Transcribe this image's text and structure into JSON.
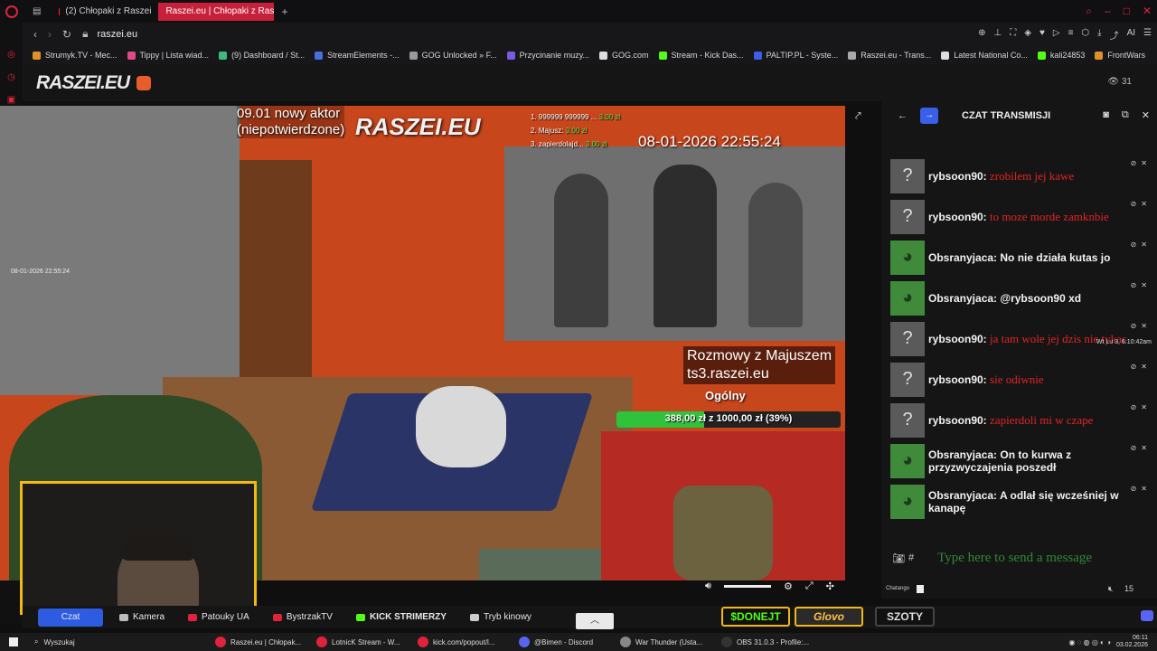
{
  "browser": {
    "tabs": [
      {
        "label": "(2) Chłopaki z Raszei"
      },
      {
        "label": "Raszei.eu | Chłopaki z Ras"
      }
    ],
    "url": "raszei.eu",
    "bookmarks": [
      {
        "label": "Strumyk.TV - Mec...",
        "icon": "orange",
        "color": "#e0902a"
      },
      {
        "label": "Tippy | Lista wiad...",
        "icon": "pink",
        "color": "#e04a8a"
      },
      {
        "label": "(9) Dashboard / St...",
        "icon": "green",
        "color": "#3dbb7a"
      },
      {
        "label": "StreamElements -...",
        "icon": "blue",
        "color": "#4a6ee0"
      },
      {
        "label": "GOG Unlocked » F...",
        "icon": "gray",
        "color": "#999999"
      },
      {
        "label": "Przycinanie muzy...",
        "icon": "purple",
        "color": "#7a5be0"
      },
      {
        "label": "GOG.com",
        "icon": "white",
        "color": "#dddddd"
      },
      {
        "label": "Stream - Kick Das...",
        "icon": "green",
        "color": "#53fc18"
      },
      {
        "label": "PALTIP.PL - Syste...",
        "icon": "blue",
        "color": "#3a5fe8"
      },
      {
        "label": "Raszei.eu - Trans...",
        "icon": "gray",
        "color": "#aaaaaa"
      },
      {
        "label": "Latest National Co...",
        "icon": "white",
        "color": "#dddddd"
      },
      {
        "label": "kali24853",
        "icon": "green",
        "color": "#53fc18"
      },
      {
        "label": "FrontWars",
        "icon": "orange",
        "color": "#e0902a"
      }
    ]
  },
  "site": {
    "logo": "RASZEI.EU",
    "viewers": "31"
  },
  "stream": {
    "overlay_aktor": "09.01 nowy aktor",
    "overlay_aktor2": "(niepotwierdzone)",
    "overlay_logo": "RASZEI.EU",
    "ranking": [
      {
        "name": "1. 999999 999999 ...",
        "amount": "3.00 zł"
      },
      {
        "name": "2. Majusz:",
        "amount": "3.00 zł"
      },
      {
        "name": "3. zapierdolajd...",
        "amount": "3.00 zł"
      }
    ],
    "datetime": "08-01-2026 22:55:24",
    "cam_timestamp": "08-01-2026 22:55:24",
    "rozmowy": "Rozmowy z Majuszem",
    "ts": "ts3.raszei.eu",
    "channel": "Ogólny",
    "goal_text": "388,00 zł z 1000,00 zł (39%)",
    "goal_progress": 0.39
  },
  "toolbar": {
    "czat": "Czat",
    "kamera": "Kamera",
    "patouky": "Patouky UA",
    "bystrzak": "BystrzakTV",
    "kick": "KICK STRIMERZY",
    "kinowy": "Tryb kinowy",
    "donejt": "$DONEJT",
    "glovo": "Glovo",
    "szoty": "SZOTY"
  },
  "chat": {
    "title": "CZAT TRANSMISJI",
    "input_placeholder": "Type here to send a message",
    "footer_label": "Chatango",
    "footer_count": "15",
    "timestamp": "Wt Lu 3, 6:10:42am",
    "messages": [
      {
        "user": "rybsoon90:",
        "text": "zrobilem jej kawe",
        "avatar": "question",
        "red": true
      },
      {
        "user": "rybsoon90:",
        "text": "to moze morde zamknbie",
        "avatar": "question",
        "red": true
      },
      {
        "user": "Obsranyjaca:",
        "text": "No nie działa kutas jo",
        "avatar": "frog",
        "red": false
      },
      {
        "user": "Obsranyjaca:",
        "text": "@rybsoon90 xd",
        "avatar": "frog",
        "red": false
      },
      {
        "user": "rybsoon90:",
        "text": "ja tam wole jej dzis nie tykac",
        "avatar": "question",
        "red": true
      },
      {
        "user": "rybsoon90:",
        "text": "sie odiwnie",
        "avatar": "question",
        "red": true
      },
      {
        "user": "rybsoon90:",
        "text": "zapierdoli mi w czape",
        "avatar": "question",
        "red": true
      },
      {
        "user": "Obsranyjaca:",
        "text": "On to kurwa z przyzwyczajenia poszedł",
        "avatar": "frog",
        "red": false
      },
      {
        "user": "Obsranyjaca:",
        "text": "A odlał się wcześniej w kanapę",
        "avatar": "frog",
        "red": false
      }
    ]
  },
  "taskbar": {
    "search": "Wyszukaj",
    "apps": [
      {
        "label": "Raszei.eu | Chłopak...",
        "color": "#e0233b"
      },
      {
        "label": "LotnicK Stream - W...",
        "color": "#e0233b"
      },
      {
        "label": "kick.com/popout/l...",
        "color": "#e0233b"
      },
      {
        "label": "@Bimen - Discord",
        "color": "#5865f2"
      },
      {
        "label": "War Thunder (Usta...",
        "color": "#888888"
      },
      {
        "label": "OBS 31.0.3 - Profile:...",
        "color": "#333333"
      }
    ],
    "time": "06:11",
    "date": "03.02.2026"
  }
}
